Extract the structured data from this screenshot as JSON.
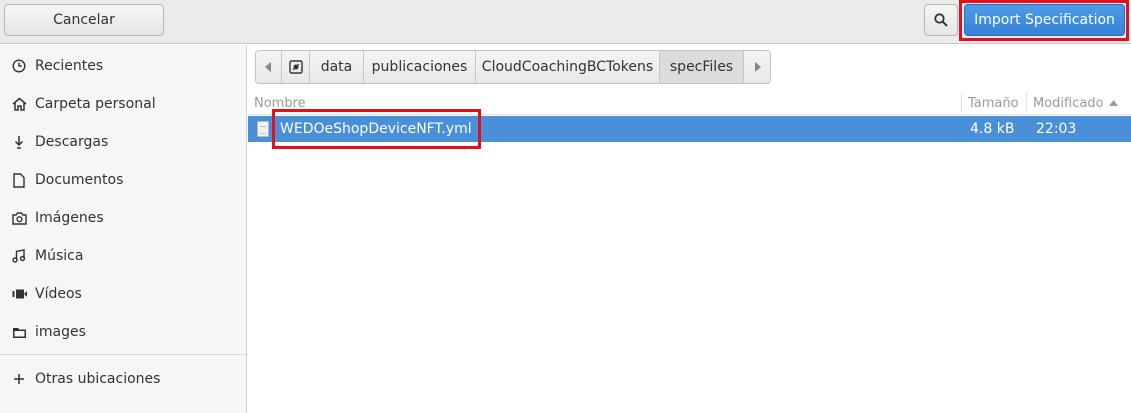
{
  "header": {
    "cancel_label": "Cancelar",
    "search_icon": "search-icon",
    "primary_label": "Import Specification"
  },
  "sidebar": {
    "items": [
      {
        "icon": "clock-icon",
        "label": "Recientes"
      },
      {
        "icon": "home-icon",
        "label": "Carpeta personal"
      },
      {
        "icon": "download-icon",
        "label": "Descargas"
      },
      {
        "icon": "document-icon",
        "label": "Documentos"
      },
      {
        "icon": "camera-icon",
        "label": "Imágenes"
      },
      {
        "icon": "music-icon",
        "label": "Música"
      },
      {
        "icon": "video-icon",
        "label": "Vídeos"
      },
      {
        "icon": "folder-icon",
        "label": "images"
      }
    ],
    "other_locations": {
      "icon": "plus-icon",
      "label": "Otras ubicaciones"
    }
  },
  "pathbar": {
    "crumbs": [
      "data",
      "publicaciones",
      "CloudCoachingBCTokens",
      "specFiles"
    ],
    "active": "specFiles"
  },
  "columns": {
    "name": "Nombre",
    "size": "Tamaño",
    "modified": "Modificado"
  },
  "files": [
    {
      "name": "WEDOeShopDeviceNFT.yml",
      "size": "4.8 kB",
      "modified": "22:03",
      "selected": true
    }
  ],
  "colors": {
    "accent": "#4a90d9",
    "highlight_box": "#e0101c"
  }
}
